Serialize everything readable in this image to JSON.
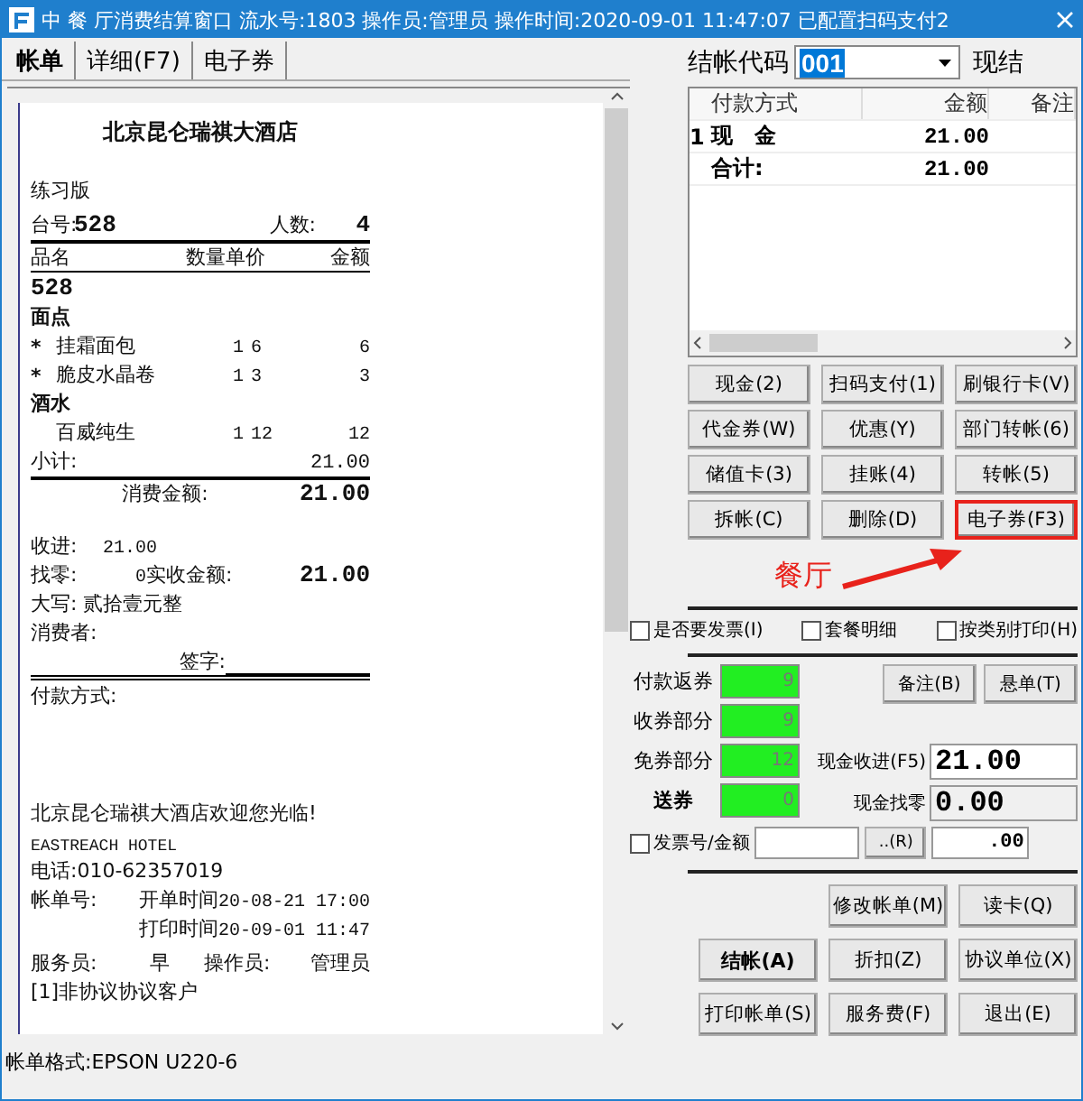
{
  "window": {
    "title": "中 餐 厅消费结算窗口 流水号:1803 操作员:管理员 操作时间:2020-09-01 11:47:07 已配置扫码支付2"
  },
  "tabs": [
    {
      "label": "帐单",
      "selected": true
    },
    {
      "label": "详细(F7)",
      "selected": false
    },
    {
      "label": "电子券",
      "selected": false
    }
  ],
  "receipt": {
    "title": "北京昆仑瑞祺大酒店",
    "edition": "练习版",
    "lines": [
      {
        "kind": "table_no",
        "cells": [
          "台号:",
          "528",
          "人数:",
          "4"
        ]
      },
      {
        "kind": "header",
        "cells": [
          "品名",
          "数量单价",
          "金额"
        ]
      },
      {
        "kind": "bold",
        "cells": [
          "528"
        ]
      },
      {
        "kind": "group",
        "cells": [
          "面点"
        ]
      },
      {
        "kind": "item",
        "cells": [
          "*",
          "挂霜面包",
          "1",
          "6",
          "6"
        ]
      },
      {
        "kind": "item",
        "cells": [
          "*",
          "脆皮水晶卷",
          "1",
          "3",
          "3"
        ]
      },
      {
        "kind": "group",
        "cells": [
          "酒水"
        ]
      },
      {
        "kind": "item",
        "cells": [
          "",
          "百威纯生",
          "1",
          "12",
          "12"
        ]
      },
      {
        "kind": "subtotal",
        "cells": [
          "小计:",
          "21.00"
        ]
      },
      {
        "kind": "total",
        "cells": [
          "消费金额:",
          "21.00"
        ]
      }
    ],
    "settlement": [
      {
        "kind": "pair",
        "cells": [
          "收进:",
          "21.00"
        ]
      },
      {
        "kind": "change",
        "cells": [
          "找零:",
          "0",
          "实收金额:",
          "21.00"
        ]
      },
      {
        "kind": "text",
        "cells": [
          "大写: 贰拾壹元整"
        ]
      },
      {
        "kind": "text",
        "cells": [
          "消费者:"
        ]
      },
      {
        "kind": "sign",
        "cells": [
          "签字:"
        ]
      },
      {
        "kind": "text",
        "cells": [
          "付款方式:"
        ]
      }
    ],
    "footer": [
      {
        "kind": "text",
        "cells": [
          "北京昆仑瑞祺大酒店欢迎您光临!"
        ]
      },
      {
        "kind": "mono",
        "cells": [
          "EASTREACH HOTEL"
        ]
      },
      {
        "kind": "text",
        "cells": [
          "电话:010-62357019"
        ]
      },
      {
        "kind": "time",
        "cells": [
          "帐单号:",
          "开单时间",
          "20-08-21 17:00"
        ]
      },
      {
        "kind": "time",
        "cells": [
          "打印时间",
          "20-09-01 11:47"
        ]
      },
      {
        "kind": "staff",
        "cells": [
          "服务员:",
          "早",
          "操作员:",
          "管理员"
        ]
      },
      {
        "kind": "text",
        "cells": [
          "[1]非协议协议客户"
        ]
      }
    ]
  },
  "status_bar": "帐单格式:EPSON U220-6",
  "checkout": {
    "label": "结帐代码",
    "code": "001",
    "code_selected": true,
    "mode": "现结"
  },
  "payments": {
    "columns": [
      "付款方式",
      "金额",
      "备注"
    ],
    "rows": [
      {
        "index": "1",
        "method": "现　金",
        "amount": "21.00"
      },
      {
        "method": "合计:",
        "amount": "21.00"
      }
    ]
  },
  "payment_buttons": [
    {
      "label": "现金(2)",
      "highlighted": false
    },
    {
      "label": "扫码支付(1)",
      "highlighted": false
    },
    {
      "label": "刷银行卡(V)",
      "highlighted": false
    },
    {
      "label": "代金券(W)",
      "highlighted": false
    },
    {
      "label": "优惠(Y)",
      "highlighted": false
    },
    {
      "label": "部门转帐(6)",
      "highlighted": false
    },
    {
      "label": "储值卡(3)",
      "highlighted": false
    },
    {
      "label": "挂账(4)",
      "highlighted": false
    },
    {
      "label": "转帐(5)",
      "highlighted": false
    },
    {
      "label": "拆帐(C)",
      "highlighted": false
    },
    {
      "label": "删除(D)",
      "highlighted": false
    },
    {
      "label": "电子券(F3)",
      "highlighted": true
    }
  ],
  "annotation": "餐厅",
  "options": [
    {
      "label": "是否要发票(I)",
      "checked": false
    },
    {
      "label": "套餐明细",
      "checked": false
    },
    {
      "label": "按类别打印(H)",
      "checked": false
    }
  ],
  "coupons": [
    {
      "label": "付款返券",
      "value": "9",
      "emphasized": false
    },
    {
      "label": "收券部分",
      "value": "9",
      "emphasized": false
    },
    {
      "label": "免券部分",
      "value": "12",
      "emphasized": false
    },
    {
      "label": "送券",
      "value": "0",
      "emphasized": true
    }
  ],
  "side_buttons": [
    "备注(B)",
    "悬单(T)"
  ],
  "cash": [
    {
      "label": "现金收进(F5)",
      "value": "21.00",
      "readonly": false
    },
    {
      "label": "现金找零",
      "value": "0.00",
      "readonly": true
    }
  ],
  "invoice": {
    "label": "发票号/金额",
    "checked": false,
    "button": "..(R)",
    "amount": ".00"
  },
  "action_rows": [
    [
      {
        "label": "修改帐单(M)",
        "primary": false
      },
      {
        "label": "读卡(Q)",
        "primary": false
      }
    ],
    [
      {
        "label": "结帐(A)",
        "primary": true
      },
      {
        "label": "折扣(Z)",
        "primary": false
      },
      {
        "label": "协议单位(X)",
        "primary": false
      }
    ],
    [
      {
        "label": "打印帐单(S)",
        "primary": false
      },
      {
        "label": "服务费(F)",
        "primary": false
      },
      {
        "label": "退出(E)",
        "primary": false
      }
    ]
  ]
}
